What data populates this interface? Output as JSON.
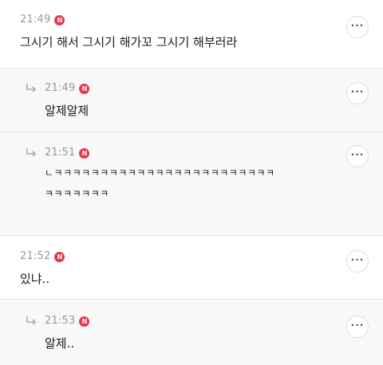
{
  "comments": [
    {
      "time": "21:49",
      "badge": "N",
      "text": "그시기 해서 그시기 해가꼬 그시기 해부러라",
      "is_reply": false,
      "more_icon": "more-horizontal-icon",
      "more_label": "···"
    },
    {
      "time": "21:49",
      "badge": "N",
      "text": "알제알제",
      "is_reply": true,
      "more_icon": "more-horizontal-icon",
      "more_label": "···"
    },
    {
      "time": "21:51",
      "badge": "N",
      "text_line1": "ㄴㅋㅋㅋㅋㅋㅋㅋㅋㅋㅋㅋㅋㅋㅋㅋㅋㅋㅋㅋㅋㅋㅋㅋㅋ",
      "text_line2": "ㅋㅋㅋㅋㅋㅋㅋ",
      "is_reply": true,
      "more_icon": "more-horizontal-icon",
      "more_label": "···"
    },
    {
      "time": "21:52",
      "badge": "N",
      "text": "있냐..",
      "is_reply": false,
      "more_icon": "more-horizontal-icon",
      "more_label": "···"
    },
    {
      "time": "21:53",
      "badge": "N",
      "text": "알제..",
      "is_reply": true,
      "more_icon": "more-horizontal-icon",
      "more_label": "···"
    }
  ],
  "colors": {
    "badge": "#e8374d",
    "time": "#9a9a9a",
    "reply_background": "#f8f8f8",
    "divider": "#e6e6e6"
  },
  "icons": {
    "reply": "reply-arrow-icon",
    "new": "new-badge-icon",
    "more": "more-horizontal-icon"
  }
}
